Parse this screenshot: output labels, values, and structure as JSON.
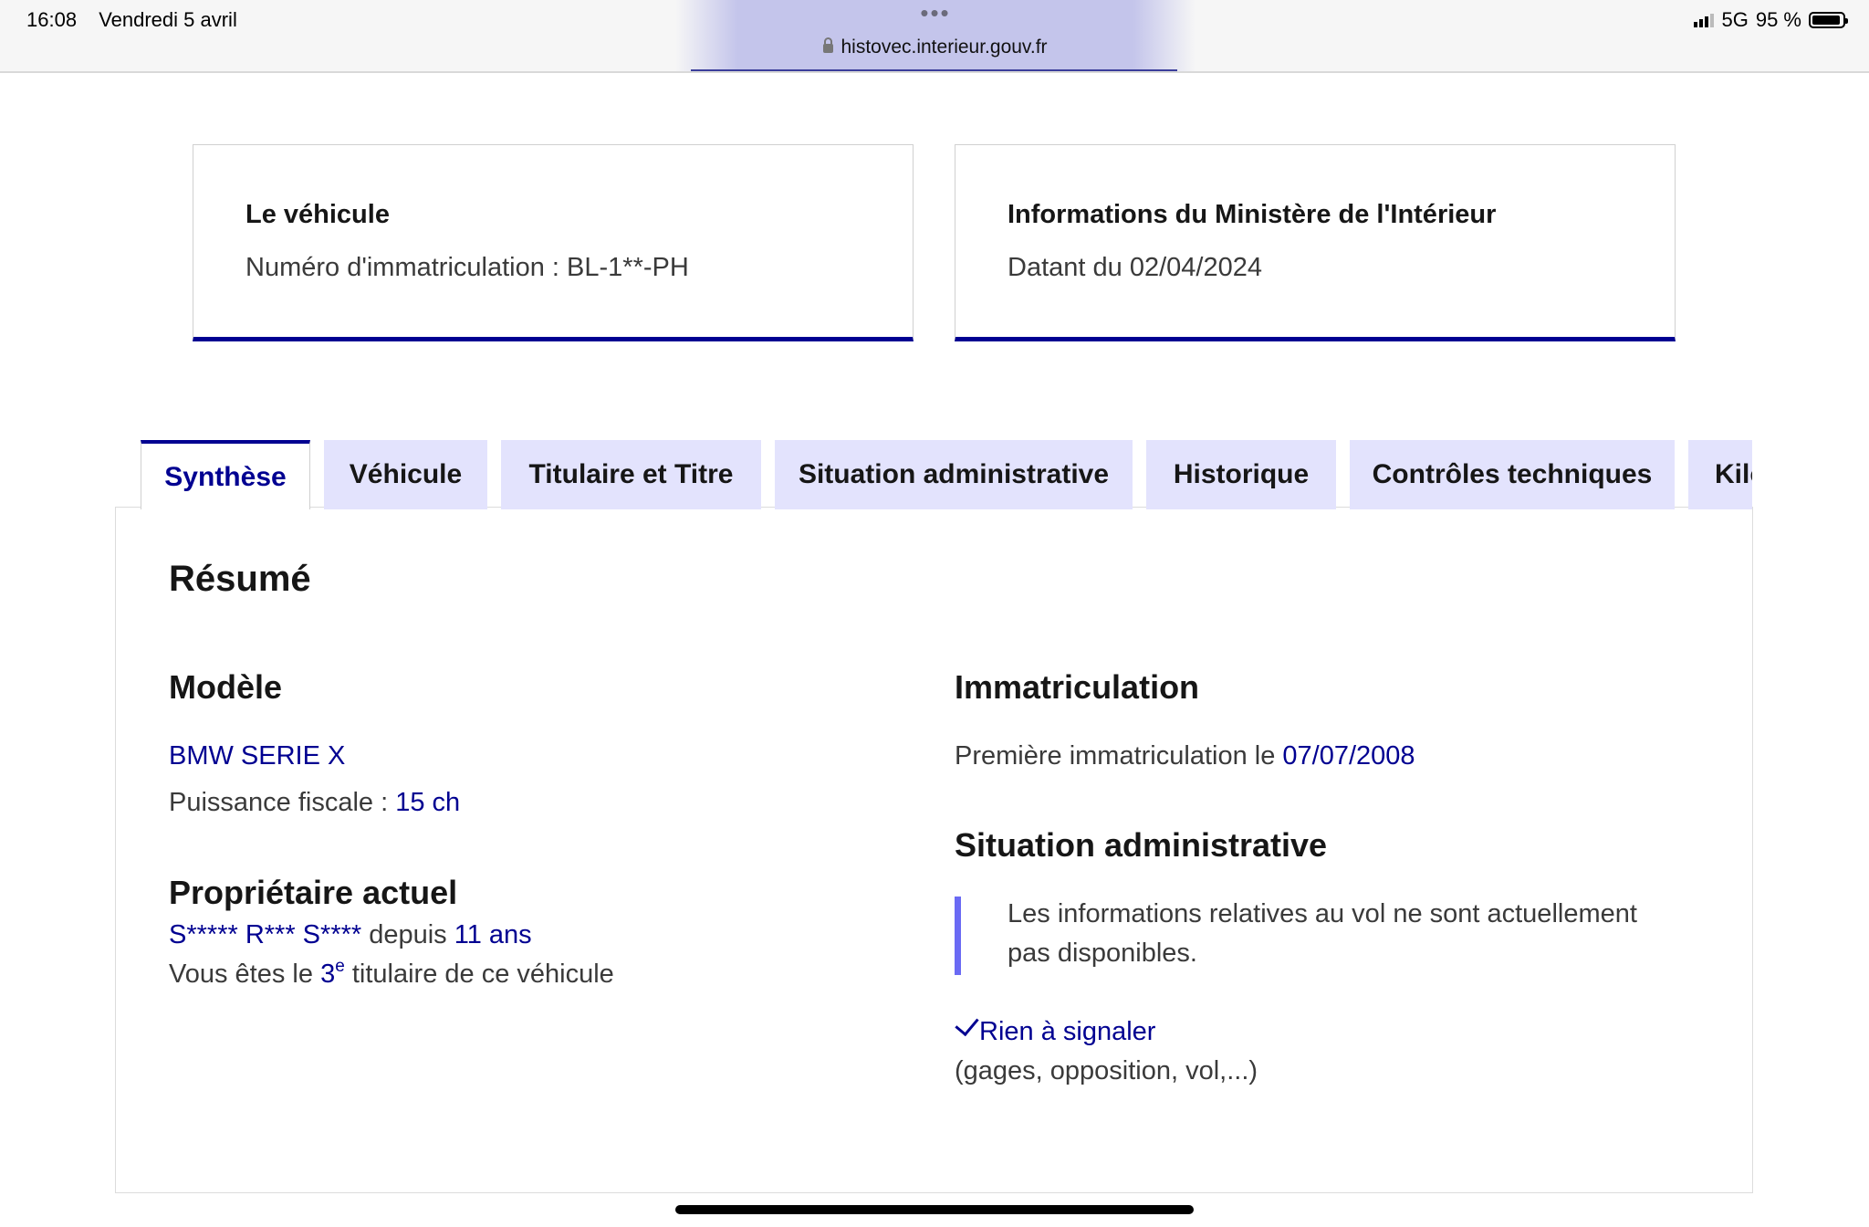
{
  "statusbar": {
    "time": "16:08",
    "date": "Vendredi 5 avril",
    "url_dots": "•••",
    "url": "histovec.interieur.gouv.fr",
    "network": "5G",
    "battery": "95 %",
    "battery_level": 0.95
  },
  "cards": {
    "vehicle": {
      "title": "Le véhicule",
      "subtitle": "Numéro d'immatriculation : BL-1**-PH"
    },
    "ministry": {
      "title": "Informations du Ministère de l'Intérieur",
      "subtitle": "Datant du 02/04/2024"
    }
  },
  "tabs": [
    {
      "label": "Synthèse",
      "active": true
    },
    {
      "label": "Véhicule"
    },
    {
      "label": "Titulaire et Titre"
    },
    {
      "label": "Situation administrative"
    },
    {
      "label": "Historique"
    },
    {
      "label": "Contrôles techniques"
    },
    {
      "label": "Kilo"
    }
  ],
  "summary": {
    "title": "Résumé",
    "model": {
      "heading": "Modèle",
      "name": "BMW SERIE X",
      "power_label": "Puissance fiscale : ",
      "power_value": "15 ch"
    },
    "owner": {
      "heading": "Propriétaire actuel",
      "name": "S***** R*** S****",
      "since_label": " depuis ",
      "since_value": "11 ans",
      "rank_prefix": "Vous êtes le ",
      "rank_value": "3",
      "rank_sup": "e",
      "rank_suffix": " titulaire de ce véhicule"
    },
    "registration": {
      "heading": "Immatriculation",
      "first_label": "Première immatriculation le ",
      "first_date": "07/07/2008"
    },
    "admin": {
      "heading": "Situation administrative",
      "notice_line1": "Les informations relatives au vol ne sont actuellement",
      "notice_line2": "pas disponibles.",
      "status": "Rien à signaler",
      "details": "(gages, opposition, vol,...)"
    }
  }
}
